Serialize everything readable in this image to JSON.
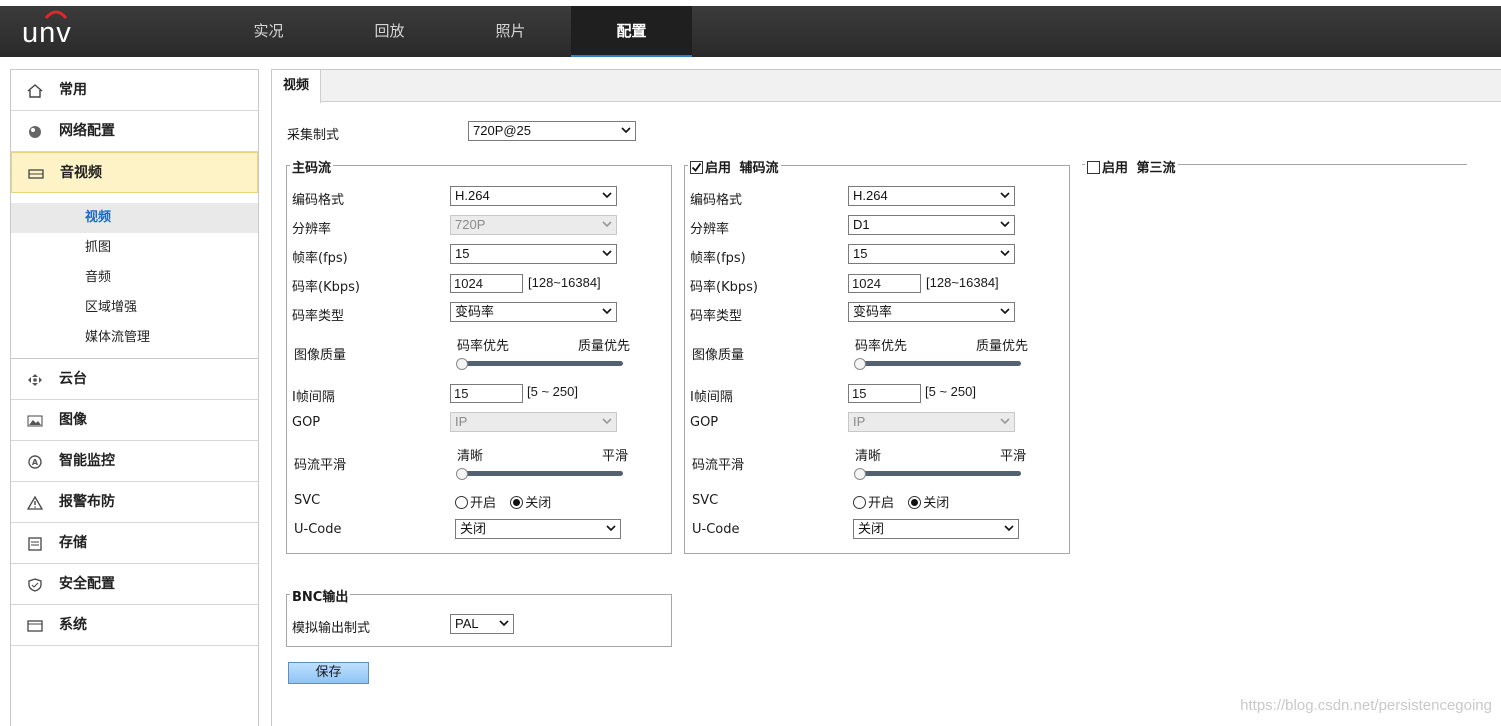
{
  "brand": {
    "logo_text": "unv",
    "accent": "#2f7dc8"
  },
  "nav": {
    "tabs": [
      "实况",
      "回放",
      "照片",
      "配置"
    ],
    "active": "配置"
  },
  "sidebar": {
    "items": [
      {
        "label": "常用",
        "icon": "home-icon"
      },
      {
        "label": "网络配置",
        "icon": "globe-icon"
      },
      {
        "label": "音视频",
        "icon": "video-icon"
      },
      {
        "label": "云台",
        "icon": "ptz-icon"
      },
      {
        "label": "图像",
        "icon": "image-icon"
      },
      {
        "label": "智能监控",
        "icon": "smart-icon"
      },
      {
        "label": "报警布防",
        "icon": "warning-icon"
      },
      {
        "label": "存储",
        "icon": "storage-icon"
      },
      {
        "label": "安全配置",
        "icon": "shield-icon"
      },
      {
        "label": "系统",
        "icon": "system-icon"
      }
    ],
    "sub_items": [
      "视频",
      "抓图",
      "音频",
      "区域增强",
      "媒体流管理"
    ]
  },
  "content": {
    "tab": "视频",
    "capture_mode_label": "采集制式",
    "capture_mode_value": "720P@25",
    "main_stream": {
      "legend": "主码流",
      "codec_label": "编码格式",
      "codec": "H.264",
      "resolution_label": "分辨率",
      "resolution": "720P",
      "fps_label": "帧率(fps)",
      "fps": "15",
      "bitrate_label": "码率(Kbps)",
      "bitrate": "1024",
      "bitrate_hint": "[128~16384]",
      "bitrate_type_label": "码率类型",
      "bitrate_type": "变码率",
      "quality_label": "图像质量",
      "quality_left": "码率优先",
      "quality_right": "质量优先",
      "iframe_label": "I帧间隔",
      "iframe": "15",
      "iframe_hint": "[5 ~ 250]",
      "gop_label": "GOP",
      "gop": "IP",
      "smooth_label": "码流平滑",
      "smooth_left": "清晰",
      "smooth_right": "平滑",
      "svc_label": "SVC",
      "svc_on": "开启",
      "svc_off": "关闭",
      "ucode_label": "U-Code",
      "ucode": "关闭"
    },
    "sub_stream": {
      "enable_label": "启用",
      "legend": "辅码流",
      "enabled": true,
      "codec_label": "编码格式",
      "codec": "H.264",
      "resolution_label": "分辨率",
      "resolution": "D1",
      "fps_label": "帧率(fps)",
      "fps": "15",
      "bitrate_label": "码率(Kbps)",
      "bitrate": "1024",
      "bitrate_hint": "[128~16384]",
      "bitrate_type_label": "码率类型",
      "bitrate_type": "变码率",
      "quality_label": "图像质量",
      "quality_left": "码率优先",
      "quality_right": "质量优先",
      "iframe_label": "I帧间隔",
      "iframe": "15",
      "iframe_hint": "[5 ~ 250]",
      "gop_label": "GOP",
      "gop": "IP",
      "smooth_label": "码流平滑",
      "smooth_left": "清晰",
      "smooth_right": "平滑",
      "svc_label": "SVC",
      "svc_on": "开启",
      "svc_off": "关闭",
      "ucode_label": "U-Code",
      "ucode": "关闭"
    },
    "third_stream": {
      "enable_label": "启用",
      "legend": "第三流",
      "enabled": false
    },
    "bnc": {
      "legend": "BNC输出",
      "mode_label": "模拟输出制式",
      "mode": "PAL"
    },
    "save_label": "保存",
    "watermark": "https://blog.csdn.net/persistencegoing"
  }
}
